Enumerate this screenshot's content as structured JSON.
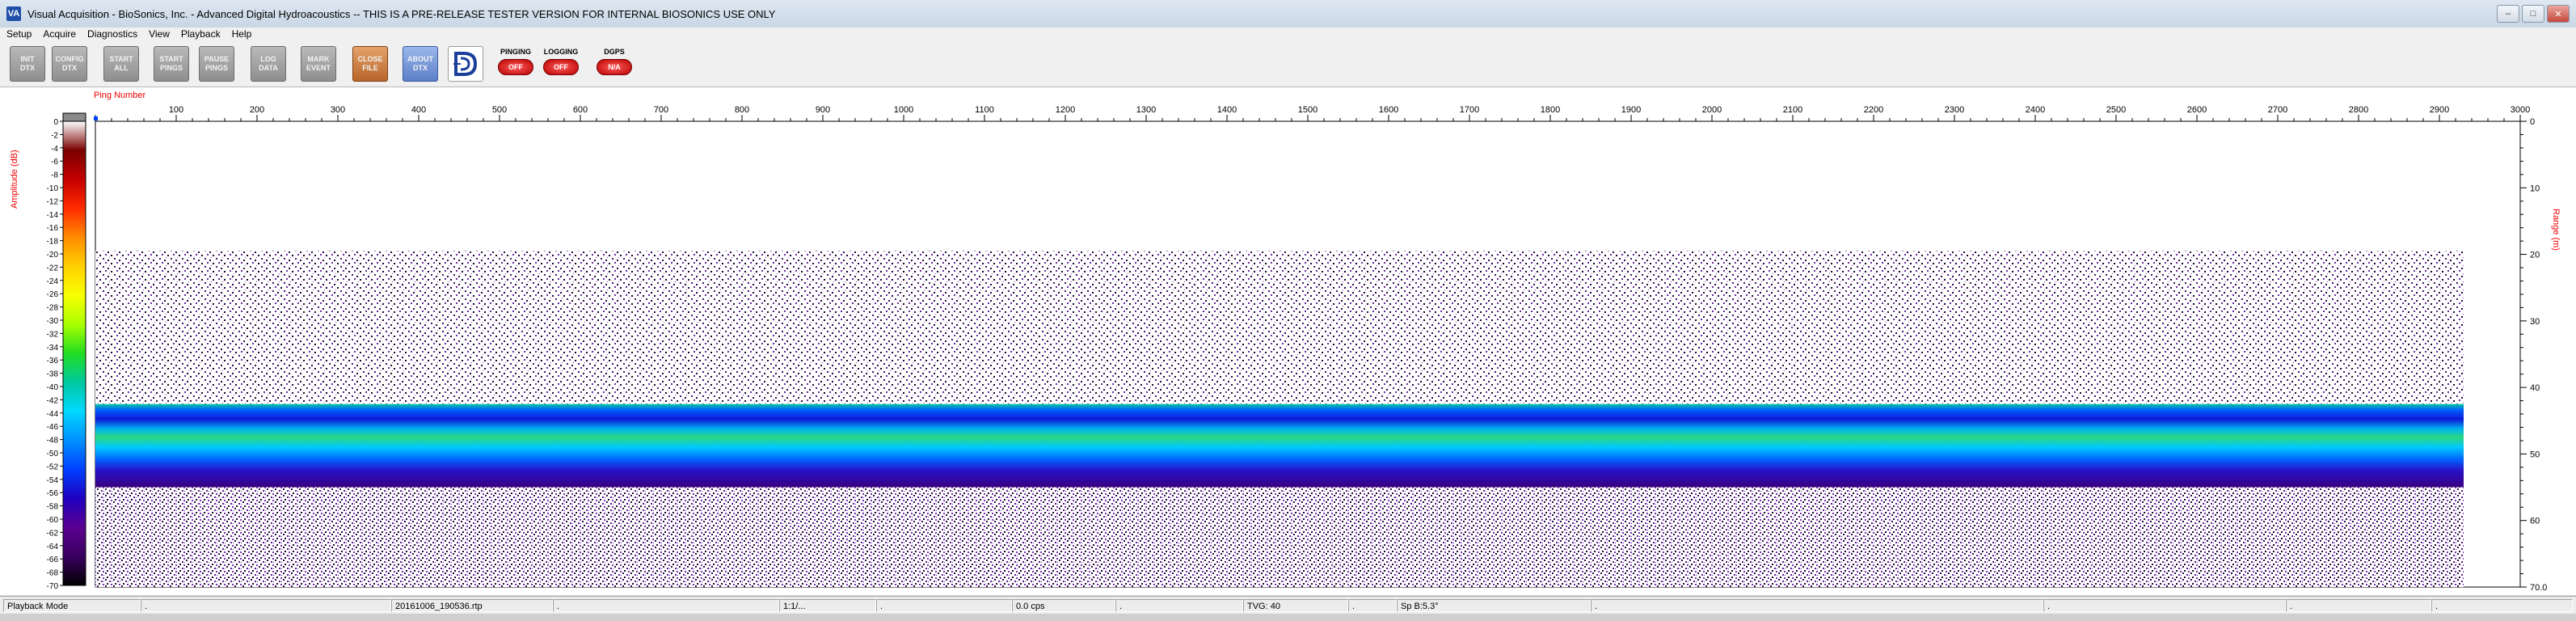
{
  "window": {
    "title": "Visual Acquisition  -  BioSonics, Inc.  -  Advanced Digital Hydroacoustics  -- THIS IS A PRE-RELEASE TESTER VERSION FOR INTERNAL BIOSONICS USE ONLY",
    "icon_text": "VA",
    "controls": {
      "minimize": "–",
      "maximize": "□",
      "close": "✕"
    }
  },
  "menu": [
    "Setup",
    "Acquire",
    "Diagnostics",
    "View",
    "Playback",
    "Help"
  ],
  "toolbar": {
    "buttons": [
      {
        "label": "INIT\nDTX",
        "style": "gray",
        "icon": "init-dtx"
      },
      {
        "label": "CONFIG\nDTX",
        "style": "gray",
        "icon": "config-dtx"
      },
      {
        "label": "START\nALL",
        "style": "gray",
        "icon": "start-all"
      },
      {
        "label": "START\nPINGS",
        "style": "gray",
        "icon": "start-pings"
      },
      {
        "label": "PAUSE\nPINGS",
        "style": "gray",
        "icon": "pause-pings"
      },
      {
        "label": "LOG\nDATA",
        "style": "gray",
        "icon": "log-data"
      },
      {
        "label": "MARK\nEVENT",
        "style": "gray",
        "icon": "mark-event"
      },
      {
        "label": "CLOSE\nFILE",
        "style": "orange",
        "icon": "close-file"
      },
      {
        "label": "ABOUT\nDTX",
        "style": "blue",
        "icon": "about-dtx"
      }
    ],
    "logo_icon": "biosonics-logo-icon",
    "indicators": [
      {
        "label": "PINGING",
        "value": "OFF"
      },
      {
        "label": "LOGGING",
        "value": "OFF"
      },
      {
        "label": "DGPS",
        "value": "N/A"
      }
    ]
  },
  "echogram": {
    "ping_axis_label": "Ping Number",
    "ping_ticks": [
      100,
      200,
      300,
      400,
      500,
      600,
      700,
      800,
      900,
      1000,
      1100,
      1200,
      1300,
      1400,
      1500,
      1600,
      1700,
      1800,
      1900,
      2000,
      2100,
      2200,
      2300,
      2400,
      2500,
      2600,
      2700,
      2800,
      2900,
      3000
    ],
    "ping_range": [
      0,
      3000
    ],
    "range_axis_label": "Range (m)",
    "range_ticks": [
      0,
      10,
      20,
      30,
      40,
      50,
      60
    ],
    "range_bottom_label": "70.0",
    "range_range": [
      0,
      70
    ],
    "amplitude_axis_label": "Amplitude (dB)",
    "amplitude_ticks": [
      0,
      -2,
      -4,
      -6,
      -8,
      -10,
      -12,
      -14,
      -16,
      -18,
      -20,
      -22,
      -24,
      -26,
      -28,
      -30,
      -32,
      -34,
      -36,
      -38,
      -40,
      -42,
      -44,
      -46,
      -48,
      -50,
      -52,
      -54,
      -56,
      -58,
      -60,
      -62,
      -64,
      -66,
      -68,
      -70
    ],
    "amplitude_range": [
      0,
      -70
    ],
    "colormap": [
      "#ffffff",
      "#7a0000",
      "#c40000",
      "#ff2a00",
      "#ff8c00",
      "#ffd000",
      "#f8ff00",
      "#a8ff00",
      "#22dd22",
      "#00c8a0",
      "#00d8ff",
      "#0090ff",
      "#0040ff",
      "#2000c0",
      "#5a0090",
      "#3a0060",
      "#000000"
    ],
    "data_extent_ping": 2930
  },
  "status": {
    "mode": "Playback Mode",
    "dot1": ".",
    "file": "20161006_190536.rtp",
    "dot2": ".",
    "ratio": "1:1/...",
    "dot3": ".",
    "rate": "0.0 cps",
    "dot4": ".",
    "tvg": "TVG: 40",
    "dot5": ".",
    "sp": "Sp B:5.3°",
    "dot6": ".",
    "dot7": ".",
    "dot8": ".",
    "dot9": "."
  }
}
